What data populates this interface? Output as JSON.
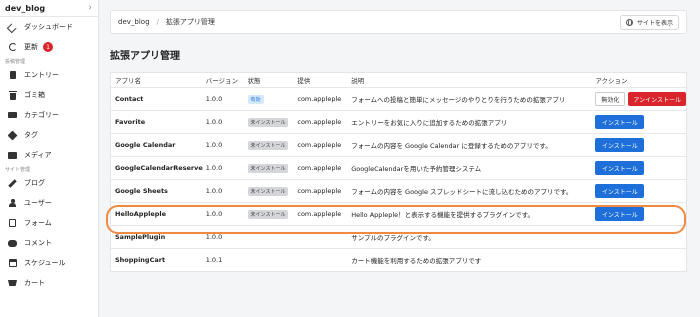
{
  "sidebar": {
    "brand": "dev_blog",
    "items": [
      {
        "label": "ダッシュボード"
      },
      {
        "label": "更新",
        "badge": "1"
      }
    ],
    "section_posts": "投稿管理",
    "post_items": [
      {
        "label": "エントリー"
      },
      {
        "label": "ゴミ箱"
      },
      {
        "label": "カテゴリー"
      },
      {
        "label": "タグ"
      },
      {
        "label": "メディア"
      }
    ],
    "section_site": "サイト管理",
    "site_items": [
      {
        "label": "ブログ"
      },
      {
        "label": "ユーザー"
      },
      {
        "label": "フォーム"
      },
      {
        "label": "コメント"
      },
      {
        "label": "スケジュール"
      },
      {
        "label": "カート"
      }
    ]
  },
  "breadcrumb": {
    "root": "dev_blog",
    "sep": "/",
    "current": "拡張アプリ管理"
  },
  "view_site_label": "サイトを表示",
  "page_title": "拡張アプリ管理",
  "table": {
    "headers": {
      "name": "アプリ名",
      "version": "バージョン",
      "status": "状態",
      "provider": "提供",
      "description": "説明",
      "action": "アクション"
    },
    "rows": [
      {
        "name": "Contact",
        "version": "1.0.0",
        "status": "有効",
        "status_kind": "on",
        "provider": "com.appleple",
        "description": "フォームへの投稿と簡単にメッセージのやりとりを行うための拡張アプリ",
        "actions": [
          "無効化",
          "アンインストール"
        ]
      },
      {
        "name": "Favorite",
        "version": "1.0.0",
        "status": "未インストール",
        "status_kind": "off",
        "provider": "com.appleple",
        "description": "エントリーをお気に入りに追加するための拡張アプリ",
        "actions": [
          "インストール"
        ]
      },
      {
        "name": "Google Calendar",
        "version": "1.0.0",
        "status": "未インストール",
        "status_kind": "off",
        "provider": "com.appleple",
        "description": "フォームの内容を Google Calendar に登録するためのアプリです。",
        "actions": [
          "インストール"
        ]
      },
      {
        "name": "GoogleCalendarReserve",
        "version": "1.0.0",
        "status": "未インストール",
        "status_kind": "off",
        "provider": "com.appleple",
        "description": "GoogleCalendarを用いた予約管理システム",
        "actions": [
          "インストール"
        ]
      },
      {
        "name": "Google Sheets",
        "version": "1.0.0",
        "status": "未インストール",
        "status_kind": "off",
        "provider": "com.appleple",
        "description": "フォームの内容を Google スプレッドシートに流し込むためのアプリです。",
        "actions": [
          "インストール"
        ]
      },
      {
        "name": "HelloAppleple",
        "version": "1.0.0",
        "status": "未インストール",
        "status_kind": "off",
        "provider": "com.appleple",
        "description": "Hello Appleple！と表示する機能を提供するプラグインです。",
        "actions": [
          "インストール"
        ]
      },
      {
        "name": "SamplePlugin",
        "version": "1.0.0",
        "status": "",
        "status_kind": "none",
        "provider": "",
        "description": "サンプルのプラグインです。",
        "actions": []
      },
      {
        "name": "ShoppingCart",
        "version": "1.0.1",
        "status": "",
        "status_kind": "none",
        "provider": "",
        "description": "カート機能を利用するための拡張アプリです",
        "actions": []
      }
    ]
  },
  "colors": {
    "accent": "#1e6fd9",
    "danger": "#d9262c",
    "highlight": "#f08a43"
  }
}
